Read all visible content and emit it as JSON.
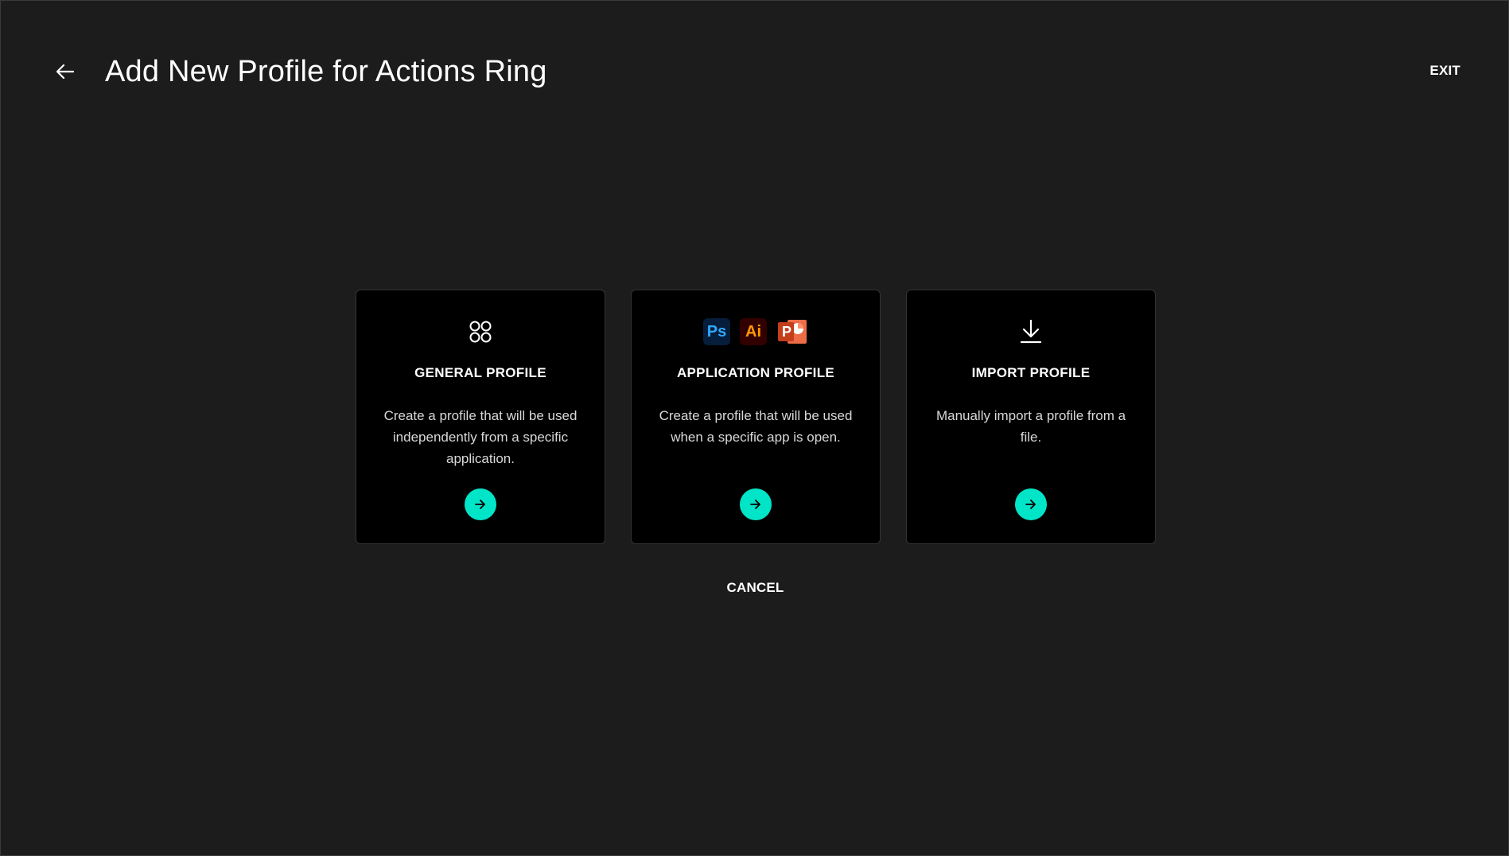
{
  "header": {
    "title": "Add New Profile for Actions Ring",
    "back_icon": "arrow-left-icon",
    "exit_label": "EXIT"
  },
  "cards": [
    {
      "icon": "apps-grid-icon",
      "title": "GENERAL PROFILE",
      "description": "Create a profile that will be used independently from a specific application.",
      "action_icon": "arrow-right-icon"
    },
    {
      "icons": [
        {
          "name": "photoshop-icon",
          "text": "Ps"
        },
        {
          "name": "illustrator-icon",
          "text": "Ai"
        },
        {
          "name": "powerpoint-icon",
          "text": "P"
        }
      ],
      "title": "APPLICATION PROFILE",
      "description": "Create a profile that will be used when a specific app is open.",
      "action_icon": "arrow-right-icon"
    },
    {
      "icon": "download-icon",
      "title": "IMPORT PROFILE",
      "description": "Manually import a profile from a file.",
      "action_icon": "arrow-right-icon"
    }
  ],
  "footer": {
    "cancel_label": "CANCEL"
  },
  "colors": {
    "background": "#1c1c1c",
    "card_background": "#000000",
    "accent": "#00e5c8",
    "photoshop_bg": "#061e3b",
    "photoshop_fg": "#31a8ff",
    "illustrator_bg": "#330000",
    "illustrator_fg": "#ff9a00",
    "powerpoint": "#d24726"
  }
}
